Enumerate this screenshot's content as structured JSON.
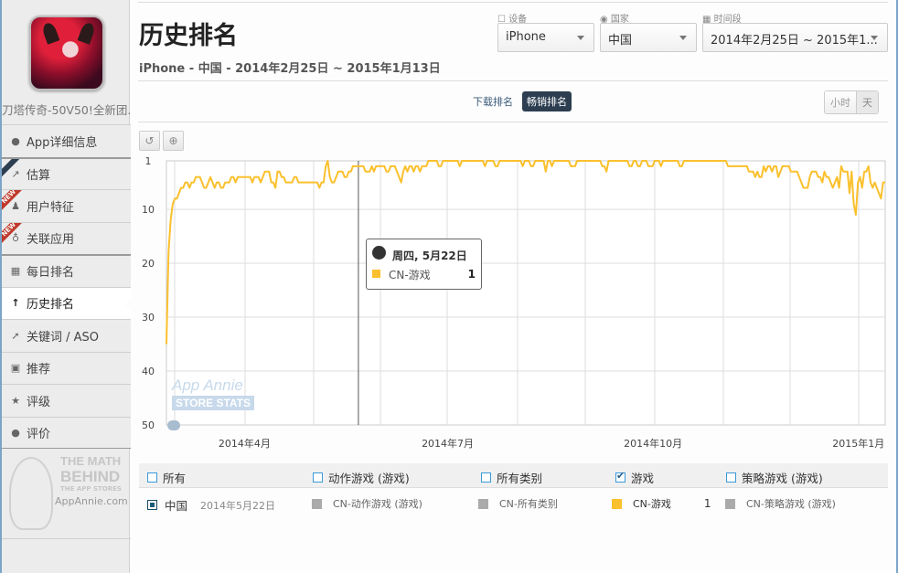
{
  "sidebar": {
    "app_name": "刀塔传奇-50V50!全新团...",
    "items": [
      {
        "label": "App详细信息",
        "icon": "info-icon",
        "badge": ""
      },
      {
        "label": "估算",
        "icon": "chart-icon",
        "badge": "ribbon"
      },
      {
        "label": "用户特征",
        "icon": "user-icon",
        "badge": "NEW"
      },
      {
        "label": "关联应用",
        "icon": "stethoscope-icon",
        "badge": "NEW"
      },
      {
        "label": "每日排名",
        "icon": "calendar-icon",
        "badge": ""
      },
      {
        "label": "历史排名",
        "icon": "arrow-up-icon",
        "badge": "",
        "active": true
      },
      {
        "label": "关键词 / ASO",
        "icon": "keyword-icon",
        "badge": ""
      },
      {
        "label": "推荐",
        "icon": "feature-icon",
        "badge": ""
      },
      {
        "label": "评级",
        "icon": "star-icon",
        "badge": ""
      },
      {
        "label": "评价",
        "icon": "comment-icon",
        "badge": ""
      }
    ],
    "promo": {
      "line1": "THE MATH",
      "line2": "BEHIND",
      "line3": "THE APP STORES",
      "line4": "AppAnnie.com"
    }
  },
  "header": {
    "title": "历史排名",
    "subtitle": "iPhone - 中国 - 2014年2月25日 ~ 2015年1月13日"
  },
  "filters": {
    "device_label": "设备",
    "device_value": "iPhone",
    "country_label": "国家",
    "country_value": "中国",
    "period_label": "时间段",
    "period_value": "2014年2月25日 ~ 2015年1..."
  },
  "tabs": [
    {
      "label": "下载排名",
      "active": false
    },
    {
      "label": "畅销排名",
      "active": true
    }
  ],
  "granularity": {
    "hour": "小时",
    "day": "天"
  },
  "toolbar": {
    "reset_icon": "↺",
    "zoom_icon": "⊕"
  },
  "tooltip": {
    "title": "周四, 5月22日",
    "series": "CN-游戏",
    "value": "1"
  },
  "watermark": {
    "line1": "App Annie",
    "line2": "STORE STATS"
  },
  "legend": {
    "headers": [
      {
        "label": "所有",
        "checked": false
      },
      {
        "label": "动作游戏 (游戏)",
        "checked": false
      },
      {
        "label": "所有类别",
        "checked": false
      },
      {
        "label": "游戏",
        "checked": true
      },
      {
        "label": "策略游戏 (游戏)",
        "checked": false
      }
    ],
    "row": {
      "country": "中国",
      "date": "2014年5月22日",
      "series": [
        {
          "name": "CN-动作游戏 (游戏)",
          "value": "",
          "color": "#aaaaaa"
        },
        {
          "name": "CN-所有类别",
          "value": "",
          "color": "#aaaaaa"
        },
        {
          "name": "CN-游戏",
          "value": "1",
          "color": "#fbc02d"
        },
        {
          "name": "CN-策略游戏 (游戏)",
          "value": "",
          "color": "#aaaaaa"
        }
      ]
    }
  },
  "chart_data": {
    "type": "line",
    "title": "",
    "xlabel": "",
    "ylabel": "",
    "y_inverted": true,
    "ylim": [
      1,
      50
    ],
    "y_ticks": [
      1,
      10,
      20,
      30,
      40,
      50
    ],
    "x_range": [
      "2014-02-25",
      "2015-01-13"
    ],
    "x_ticks": [
      "2014年4月",
      "2014年7月",
      "2014年10月",
      "2015年1月"
    ],
    "grid": true,
    "crosshair_date": "2014-05-22",
    "series": [
      {
        "name": "CN-游戏",
        "color": "#fbc02d",
        "start_date": "2014-02-25",
        "values": [
          35,
          18,
          12,
          9,
          8,
          8,
          7,
          6,
          6,
          5,
          5,
          6,
          5,
          5,
          4,
          4,
          4,
          5,
          6,
          6,
          5,
          4,
          5,
          6,
          5,
          5,
          6,
          6,
          5,
          5,
          5,
          4,
          4,
          5,
          4,
          4,
          4,
          4,
          4,
          4,
          4,
          5,
          4,
          4,
          4,
          5,
          4,
          3,
          3,
          3,
          5,
          5,
          6,
          3,
          3,
          4,
          4,
          5,
          5,
          5,
          5,
          4,
          4,
          5,
          5,
          5,
          5,
          5,
          5,
          5,
          5,
          5,
          5,
          6,
          5,
          5,
          2,
          1,
          4,
          5,
          5,
          4,
          3,
          3,
          3,
          4,
          4,
          3,
          3,
          2,
          2,
          2,
          2,
          2,
          2,
          3,
          3,
          3,
          2,
          3,
          2,
          2,
          2,
          2,
          2,
          3,
          3,
          2,
          2,
          2,
          3,
          4,
          5,
          3,
          2,
          3,
          2,
          2,
          3,
          2,
          2,
          3,
          2,
          2,
          2,
          1,
          1,
          1,
          1,
          1,
          2,
          2,
          1,
          1,
          1,
          1,
          1,
          1,
          1,
          1,
          2,
          1,
          1,
          1,
          1,
          1,
          1,
          1,
          1,
          1,
          1,
          1,
          2,
          1,
          1,
          1,
          1,
          2,
          2,
          1,
          1,
          1,
          1,
          1,
          1,
          1,
          1,
          1,
          1,
          1,
          2,
          1,
          1,
          1,
          2,
          2,
          1,
          1,
          1,
          1,
          1,
          3,
          1,
          1,
          2,
          1,
          1,
          1,
          1,
          1,
          1,
          1,
          1,
          2,
          2,
          2,
          1,
          1,
          1,
          1,
          1,
          1,
          1,
          1,
          1,
          1,
          1,
          1,
          2,
          2,
          3,
          1,
          1,
          1,
          1,
          1,
          1,
          1,
          1,
          1,
          1,
          2,
          2,
          1,
          1,
          2,
          2,
          1,
          1,
          1,
          2,
          2,
          2,
          1,
          1,
          1,
          2,
          1,
          1,
          1,
          1,
          1,
          1,
          1,
          1,
          2,
          2,
          1,
          1,
          1,
          1,
          1,
          1,
          1,
          1,
          1,
          1,
          1,
          1,
          1,
          1,
          1,
          1,
          1,
          1,
          1,
          1,
          1,
          2,
          2,
          2,
          2,
          2,
          2,
          2,
          2,
          2,
          2,
          3,
          3,
          3,
          4,
          3,
          4,
          4,
          2,
          3,
          2,
          2,
          3,
          2,
          2,
          4,
          3,
          2,
          2,
          2,
          2,
          3,
          3,
          3,
          3,
          4,
          5,
          6,
          6,
          6,
          4,
          3,
          3,
          3,
          4,
          4,
          5,
          3,
          4,
          4,
          5,
          6,
          5,
          4,
          6,
          2,
          3,
          3,
          3,
          7,
          3,
          9,
          11,
          5,
          4,
          6,
          3,
          3,
          2,
          5,
          6,
          5,
          6,
          7,
          8,
          5,
          5
        ]
      }
    ]
  }
}
